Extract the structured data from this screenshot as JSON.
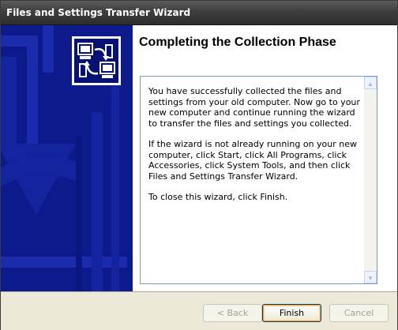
{
  "window": {
    "title": "Files and Settings Transfer Wizard"
  },
  "sidebar": {
    "logo_icon": "transfer-computers-icon",
    "background_color": "#0c1a8c"
  },
  "content": {
    "heading": "Completing the Collection Phase",
    "paragraphs": [
      "You have successfully collected the files and settings from your old computer. Now go to your new computer and continue running the wizard to transfer the files and settings you collected.",
      "If the wizard is not already running on your new computer, click Start, click All Programs, click Accessories, click System Tools, and then click Files and Settings Transfer Wizard.",
      "To close this wizard, click Finish."
    ]
  },
  "buttons": {
    "back_label": "< Back",
    "finish_label": "Finish",
    "cancel_label": "Cancel"
  }
}
